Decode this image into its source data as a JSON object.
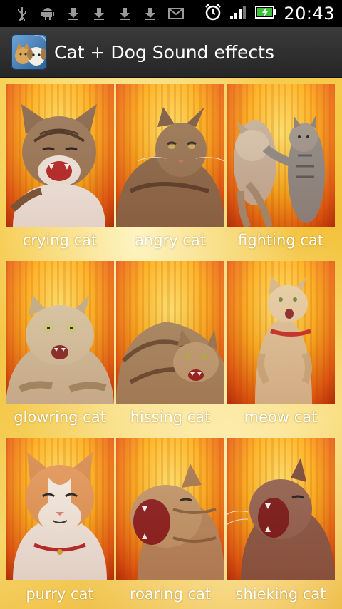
{
  "status_bar": {
    "time": "20:43",
    "icons": [
      "usb-icon",
      "android-debug-icon",
      "download-icon",
      "download-icon",
      "download-icon",
      "download-icon",
      "email-icon",
      "alarm-clock-icon",
      "signal-icon",
      "battery-charging-icon"
    ]
  },
  "action_bar": {
    "title": "Cat + Dog Sound effects",
    "icon": "app-icon"
  },
  "colors": {
    "background": "#f3c23c",
    "thumb_orange": "#e85b10",
    "thumb_yellow": "#ffe96a",
    "label_text": "#ffffff"
  },
  "sounds": [
    {
      "label": "crying cat"
    },
    {
      "label": "angry cat"
    },
    {
      "label": "fighting cat"
    },
    {
      "label": "glowring cat"
    },
    {
      "label": "hissing cat"
    },
    {
      "label": "meow cat"
    },
    {
      "label": "purry cat"
    },
    {
      "label": "roaring cat"
    },
    {
      "label": "shieking cat"
    }
  ]
}
